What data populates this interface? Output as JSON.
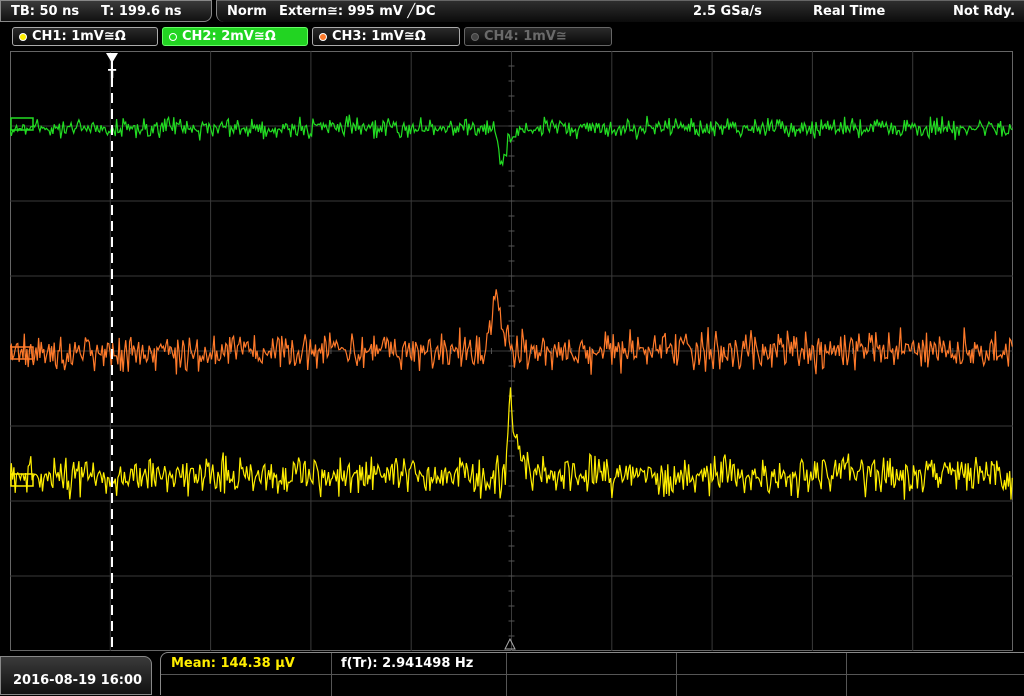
{
  "topbar": {
    "tb": "TB: 50 ns",
    "t": "T: 199.6 ns",
    "mode": "Norm",
    "trigger": "Extern≅: 995 mV ╱DC",
    "rate": "2.5 GSa/s",
    "acq": "Real Time",
    "status": "Not Rdy."
  },
  "channels": [
    {
      "label": "CH1: 1mV≅Ω",
      "color": "#ffee00"
    },
    {
      "label": "CH2: 2mV≅Ω",
      "color": "#22dd22"
    },
    {
      "label": "CH3: 1mV≅Ω",
      "color": "#ff7a2a"
    },
    {
      "label": "CH4: 1mV≅",
      "color": "#666666"
    }
  ],
  "measurements": {
    "mean_label": "Mean: 144.38 µV",
    "freq_label": "f(Tr): 2.941498 Hz"
  },
  "datetime": "2016-08-19 16:00",
  "colors": {
    "ch1": "#ffee00",
    "ch2": "#22dd22",
    "ch3": "#ff7a2a",
    "grid": "#3a3a3a",
    "cursor": "#ffffff"
  }
}
